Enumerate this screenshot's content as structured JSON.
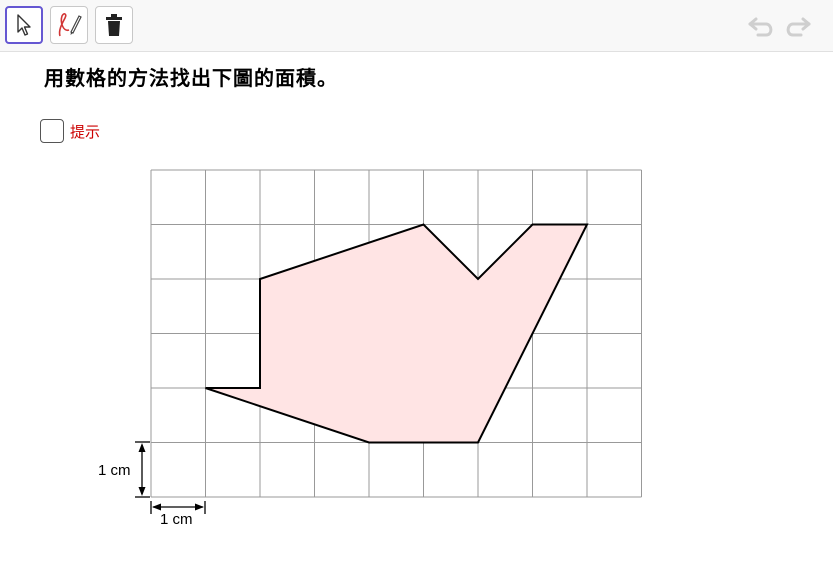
{
  "toolbar": {
    "tools": [
      {
        "name": "move",
        "icon": "arrow-cursor-icon",
        "active": true
      },
      {
        "name": "pen",
        "icon": "pen-icon",
        "active": false
      },
      {
        "name": "delete",
        "icon": "trash-icon",
        "active": false
      }
    ],
    "undo_icon": "undo-icon",
    "redo_icon": "redo-icon"
  },
  "question": {
    "text": "用數格的方法找出下圖的面積。"
  },
  "hint": {
    "label": "提示",
    "checked": false
  },
  "figure": {
    "grid_columns": 9,
    "grid_rows": 6,
    "polygon_points": [
      [
        1,
        2
      ],
      [
        2,
        2
      ],
      [
        2,
        4
      ],
      [
        5,
        5
      ],
      [
        6,
        4
      ],
      [
        7,
        5
      ],
      [
        8,
        5
      ],
      [
        6,
        1
      ],
      [
        4,
        1
      ]
    ],
    "polygon_fill": "#ffe4e4",
    "polygon_stroke": "#000000",
    "grid_color": "#999999",
    "vertical_unit_label": "1 cm",
    "horizontal_unit_label": "1 cm"
  }
}
